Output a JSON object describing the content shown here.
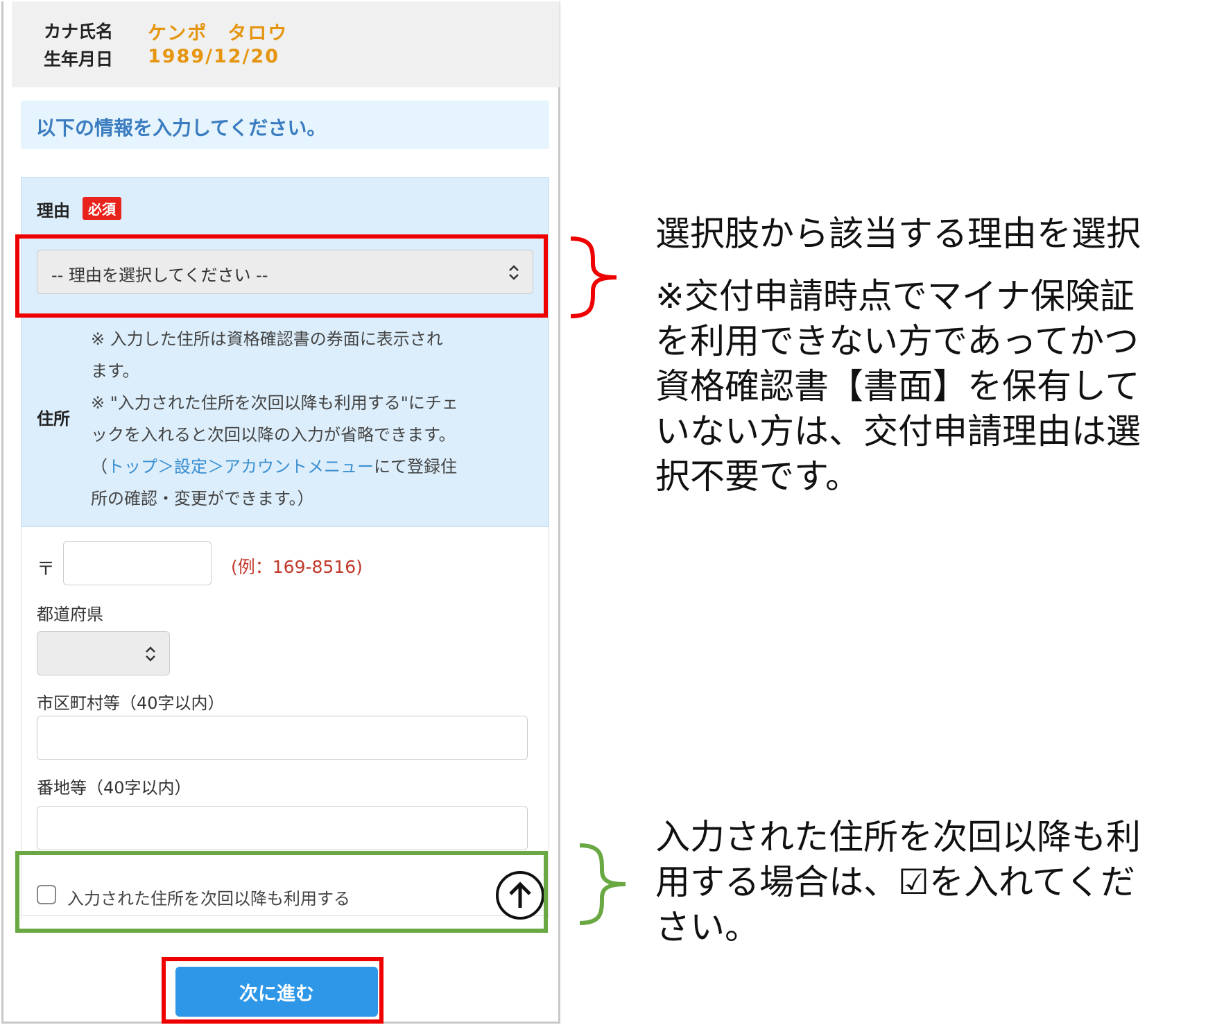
{
  "profile": {
    "kana_label": "カナ氏名",
    "kana_value": "ケンポ　タロウ",
    "birth_label": "生年月日",
    "birth_value": "1989/12/20"
  },
  "notice": "以下の情報を入力してください。",
  "reason": {
    "label": "理由",
    "required_badge": "必須",
    "select_placeholder": "-- 理由を選択してください --"
  },
  "address": {
    "label": "住所",
    "note_line1": "※ 入力した住所は資格確認書の券面に表示され",
    "note_line2": "ます。",
    "note_line3": "※ \"入力された住所を次回以降も利用する\"にチェ",
    "note_line4": "ックを入れると次回以降の入力が省略できます。",
    "note_line5_pre": "（",
    "note_line5_link": "トップ＞設定＞アカウントメニュー",
    "note_line5_post": "にて登録住",
    "note_line6": "所の確認・変更ができます。）",
    "zip_mark": "〒",
    "zip_example": "(例：169-8516)",
    "prefecture_label": "都道府県",
    "city_label": "市区町村等（40字以内）",
    "street_label": "番地等（40字以内）",
    "save_checkbox_label": "入力された住所を次回以降も利用する"
  },
  "next_button": "次に進む",
  "annotations": {
    "reason_title": "選択肢から該当する理由を選択",
    "reason_note_1": "※交付申請時点でマイナ保険証",
    "reason_note_2": "を利用できない方であってかつ",
    "reason_note_3": "資格確認書【書面】を保有して",
    "reason_note_4": "いない方は、交付申請理由は選",
    "reason_note_5": "択不要です。",
    "save_note_1": "入力された住所を次回以降も利",
    "save_note_2": "用する場合は、☑を入れてくだ",
    "save_note_3": "さい。"
  },
  "colors": {
    "highlight_red": "#ee0000",
    "highlight_green": "#6aa843",
    "primary_button": "#2f97e8",
    "profile_value": "#e59510"
  }
}
